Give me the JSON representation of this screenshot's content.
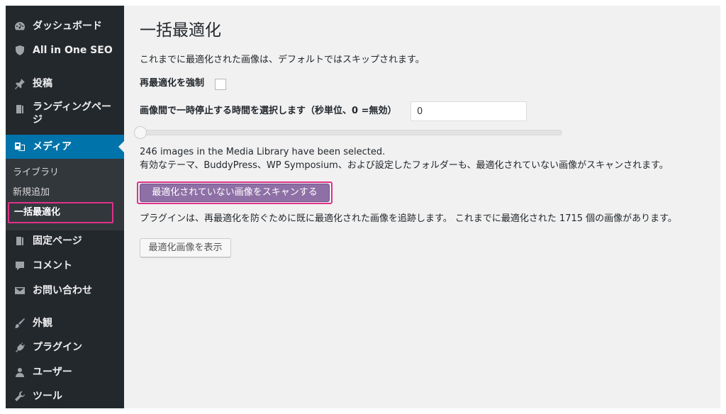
{
  "sidebar": {
    "items": [
      {
        "label": "ダッシュボード",
        "icon": "dashboard-icon"
      },
      {
        "label": "All in One SEO",
        "icon": "shield-icon"
      },
      {
        "label": "投稿",
        "icon": "pin-icon"
      },
      {
        "label": "ランディングページ",
        "icon": "page-icon"
      },
      {
        "label": "メディア",
        "icon": "media-icon"
      },
      {
        "label": "固定ページ",
        "icon": "pages-icon"
      },
      {
        "label": "コメント",
        "icon": "comment-icon"
      },
      {
        "label": "お問い合わせ",
        "icon": "mail-icon"
      },
      {
        "label": "外観",
        "icon": "appearance-icon"
      },
      {
        "label": "プラグイン",
        "icon": "plugin-icon"
      },
      {
        "label": "ユーザー",
        "icon": "user-icon"
      },
      {
        "label": "ツール",
        "icon": "wrench-icon"
      }
    ],
    "submenu": [
      "ライブラリ",
      "新規追加",
      "一括最適化"
    ],
    "colors": {
      "bg": "#23282d",
      "current": "#0073aa",
      "highlight": "#e0318a"
    }
  },
  "main": {
    "title": "一括最適化",
    "intro": "これまでに最適化された画像は、デフォルトではスキップされます。",
    "force_label": "再最適化を強制",
    "pause_label": "画像間で一時停止する時間を選択します（秒単位、0 =無効）",
    "pause_value": "0",
    "slider_value": 0,
    "selected_text": "246 images in the Media Library have been selected.",
    "scan_note": "有効なテーマ、BuddyPress、WP Symposium、および設定したフォルダーも、最適化されていない画像がスキャンされます。",
    "scan_button": "最適化されていない画像をスキャンする",
    "tracking_note": "プラグインは、再最適化を防ぐために既に最適化された画像を追跡します。 これまでに最適化された 1715 個の画像があります。",
    "show_button": "最適化画像を表示",
    "colors": {
      "button": "#8e70a6",
      "highlight": "#e0318a",
      "bg": "#f1f1f1"
    }
  }
}
